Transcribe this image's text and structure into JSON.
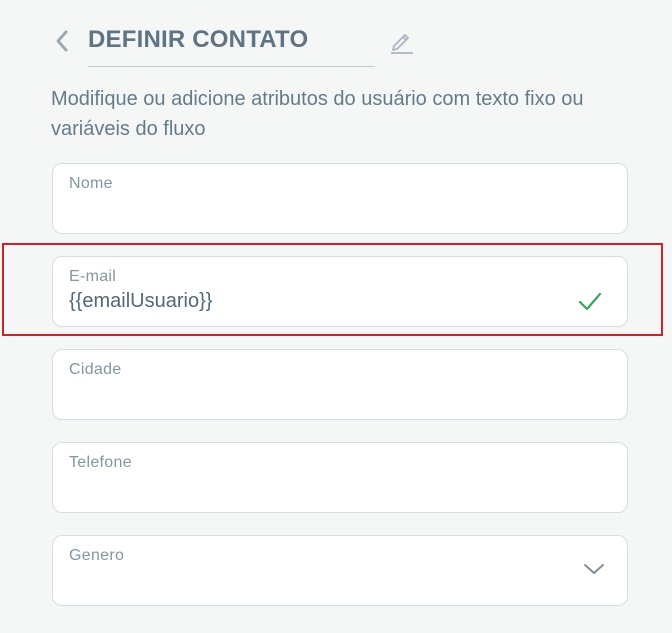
{
  "header": {
    "title": "DEFINIR CONTATO",
    "back_icon": "chevron-left-icon",
    "edit_icon": "pencil-icon"
  },
  "description": "Modifique ou adicione atributos do usuário com texto fixo ou variáveis do fluxo",
  "fields": [
    {
      "label": "Nome",
      "value": ""
    },
    {
      "label": "E-mail",
      "value": "{{emailUsuario}}",
      "status_icon": "checkmark-icon",
      "status_color": "#3aa55a",
      "highlighted": true
    },
    {
      "label": "Cidade",
      "value": ""
    },
    {
      "label": "Telefone",
      "value": ""
    },
    {
      "label": "Genero",
      "value": "",
      "control_icon": "chevron-down-icon"
    }
  ],
  "colors": {
    "background": "#f5f7f7",
    "text": "#5f7482",
    "highlight_border": "#d0202a"
  }
}
